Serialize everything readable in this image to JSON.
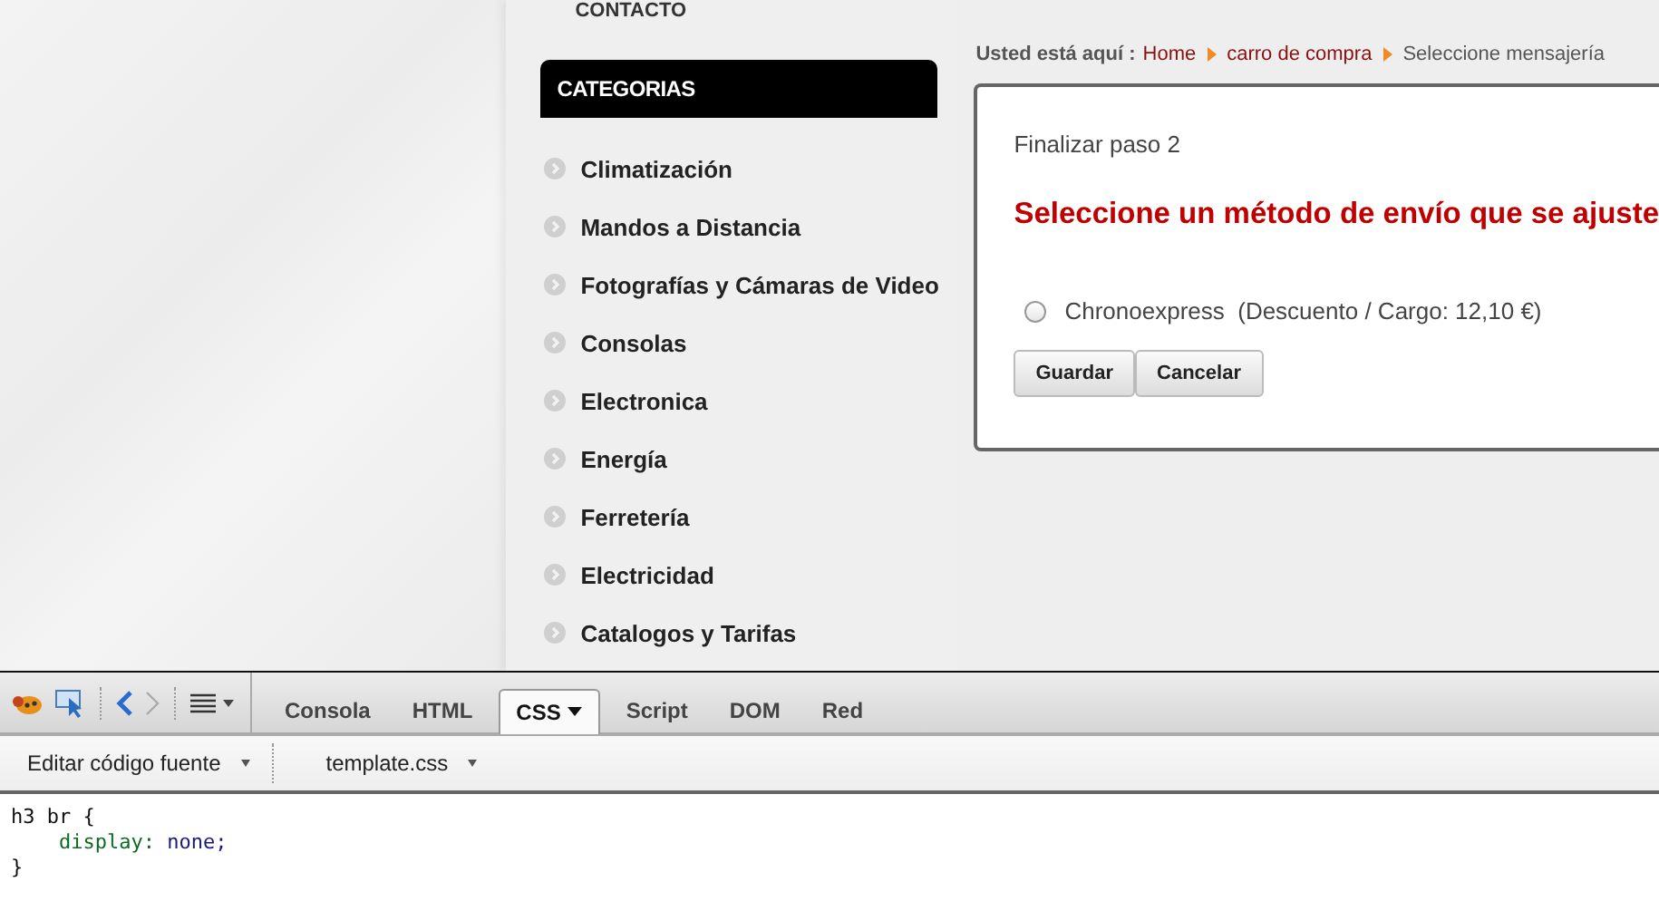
{
  "top_menu": {
    "item": "CONTACTO"
  },
  "sidebar": {
    "title": "CATEGORIAS",
    "items": [
      {
        "label": "Climatización"
      },
      {
        "label": "Mandos a Distancia"
      },
      {
        "label": "Fotografías y Cámaras de Video"
      },
      {
        "label": "Consolas"
      },
      {
        "label": "Electronica"
      },
      {
        "label": "Energía"
      },
      {
        "label": "Ferretería"
      },
      {
        "label": "Electricidad"
      },
      {
        "label": "Catalogos y Tarifas"
      }
    ]
  },
  "breadcrumb": {
    "prefix": "Usted está aquí :",
    "links": [
      "Home",
      "carro de compra"
    ],
    "current": "Seleccione mensajería"
  },
  "checkout": {
    "step": "Finalizar paso 2",
    "heading": "Seleccione un método de envío que se ajuste",
    "options": [
      {
        "name": "Chronoexpress",
        "detail": "(Descuento / Cargo: 12,10 €)",
        "selected": false
      }
    ],
    "buttons": [
      "Guardar",
      "Cancelar"
    ]
  },
  "devtools": {
    "tabs": [
      {
        "label": "Consola",
        "selected": false,
        "dropdown": false
      },
      {
        "label": "HTML",
        "selected": false,
        "dropdown": false
      },
      {
        "label": "CSS",
        "selected": true,
        "dropdown": true
      },
      {
        "label": "Script",
        "selected": false,
        "dropdown": false
      },
      {
        "label": "DOM",
        "selected": false,
        "dropdown": false
      },
      {
        "label": "Red",
        "selected": false,
        "dropdown": false
      }
    ],
    "source_menu": "Editar código fuente",
    "file_menu": "template.css",
    "code_lines": [
      [
        {
          "kind": "selector",
          "text": "h3 br {"
        }
      ],
      [
        {
          "kind": "property",
          "text": "    display:"
        },
        {
          "kind": "value",
          "text": " none;"
        }
      ],
      [
        {
          "kind": "selector",
          "text": "}"
        }
      ]
    ]
  }
}
